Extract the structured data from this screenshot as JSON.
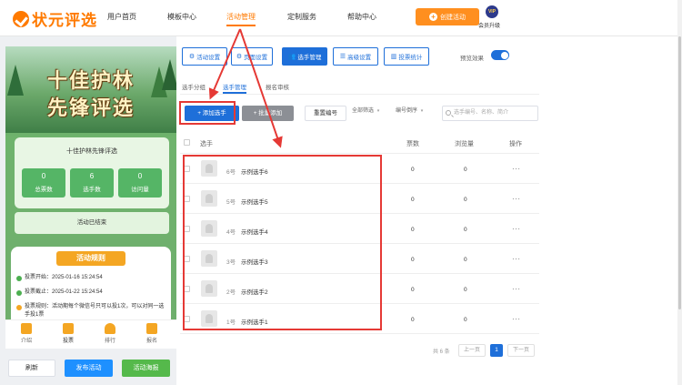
{
  "app": {
    "logo_text": "状元评选",
    "nav": [
      "用户首页",
      "模板中心",
      "活动管理",
      "定制服务",
      "帮助中心"
    ],
    "create_button": "创建活动",
    "vip_badge": "VIP",
    "vip_label": "会员升级"
  },
  "preview": {
    "banner_line1": "十佳护林",
    "banner_line2": "先锋评选",
    "stats_title": "十佳护林先锋评选",
    "stats": [
      {
        "value": "0",
        "label": "总票数"
      },
      {
        "value": "6",
        "label": "选手数"
      },
      {
        "value": "0",
        "label": "访问量"
      }
    ],
    "status_text": "活动已结束",
    "rules_title": "活动规则",
    "rules": [
      "投票开始：2025-01-16 15:24:54",
      "投票截止：2025-01-22 15:24:54",
      "投票规则：活动期每个微信号只可以投1次，可以对同一选手投1票"
    ],
    "tabbar": [
      "介绍",
      "投票",
      "排行",
      "报名"
    ]
  },
  "bottom_buttons": {
    "refresh": "刷新",
    "publish": "发布活动",
    "poster": "活动海报"
  },
  "settings_buttons": [
    "活动设置",
    "页面设置",
    "选手管理",
    "高级设置",
    "投票统计"
  ],
  "preview_effect_label": "预览效果",
  "subtabs": [
    "选手分组",
    "选手管理",
    "报名审核"
  ],
  "toolbar": {
    "add_label": "+ 添加选手",
    "import_label": "+ 批量添加",
    "reset_label": "重置编号",
    "filter_label": "全部筛选",
    "sort_label": "编号倒序",
    "search_placeholder": "选手编号、名称、简介"
  },
  "table": {
    "headers": {
      "player": "选手",
      "votes": "票数",
      "views": "浏览量",
      "ops": "操作"
    },
    "rows": [
      {
        "num": "6号",
        "name": "示例选手6",
        "votes": "0",
        "views": "0",
        "ops": "···"
      },
      {
        "num": "5号",
        "name": "示例选手5",
        "votes": "0",
        "views": "0",
        "ops": "···"
      },
      {
        "num": "4号",
        "name": "示例选手4",
        "votes": "0",
        "views": "0",
        "ops": "···"
      },
      {
        "num": "3号",
        "name": "示例选手3",
        "votes": "0",
        "views": "0",
        "ops": "···"
      },
      {
        "num": "2号",
        "name": "示例选手2",
        "votes": "0",
        "views": "0",
        "ops": "···"
      },
      {
        "num": "1号",
        "name": "示例选手1",
        "votes": "0",
        "views": "0",
        "ops": "···"
      }
    ]
  },
  "pagination": {
    "total": "共 6 条",
    "prev": "上一页",
    "current": "1",
    "next": "下一页"
  }
}
